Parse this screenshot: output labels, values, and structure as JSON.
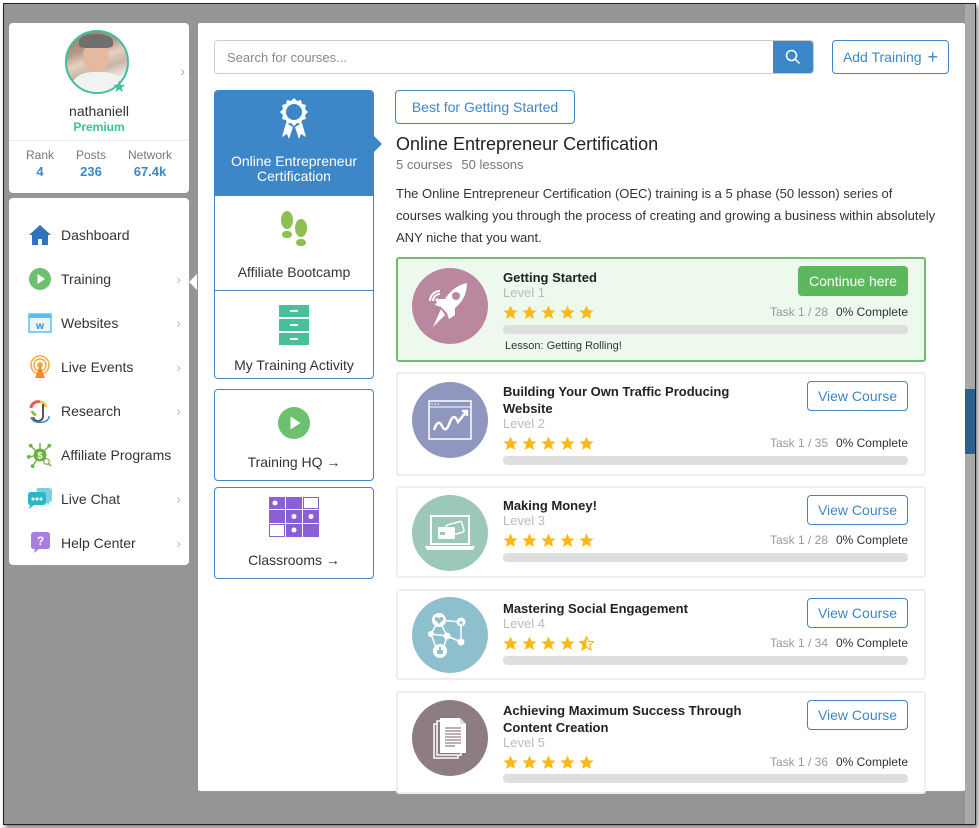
{
  "profile": {
    "username": "nathaniell",
    "tier": "Premium",
    "stats": [
      {
        "label": "Rank",
        "value": "4"
      },
      {
        "label": "Posts",
        "value": "236"
      },
      {
        "label": "Network",
        "value": "67.4k"
      }
    ]
  },
  "nav": {
    "items": [
      {
        "label": "Dashboard",
        "icon": "home-icon",
        "chevron": false
      },
      {
        "label": "Training",
        "icon": "play-circle-icon",
        "chevron": true
      },
      {
        "label": "Websites",
        "icon": "website-icon",
        "chevron": true
      },
      {
        "label": "Live Events",
        "icon": "broadcast-icon",
        "chevron": true
      },
      {
        "label": "Research",
        "icon": "research-icon",
        "chevron": true
      },
      {
        "label": "Affiliate Programs",
        "icon": "affiliate-dollar-icon",
        "chevron": false
      },
      {
        "label": "Live Chat",
        "icon": "chat-bubble-icon",
        "chevron": true
      },
      {
        "label": "Help Center",
        "icon": "help-question-icon",
        "chevron": true
      }
    ]
  },
  "search": {
    "placeholder": "Search for courses...",
    "value": ""
  },
  "toolbar": {
    "add_training_label": "Add Training",
    "add_training_icon": "+"
  },
  "categories": {
    "group": [
      {
        "label": "Online Entrepreneur Certification",
        "icon": "award-ribbon-icon",
        "active": true
      },
      {
        "label": "Affiliate Bootcamp",
        "icon": "footsteps-icon",
        "active": false
      },
      {
        "label": "My Training Activity",
        "icon": "file-cabinet-icon",
        "active": false
      }
    ],
    "links": [
      {
        "label": "Training HQ →",
        "icon": "play-circle-icon"
      },
      {
        "label": "Classrooms →",
        "icon": "classroom-grid-icon"
      }
    ]
  },
  "program": {
    "tag": "Best for Getting Started",
    "title": "Online Entrepreneur Certification",
    "courses_count": "5 courses",
    "lessons_count": "50 lessons",
    "description": "The Online Entrepreneur Certification (OEC) training is a 5 phase (50 lesson) series of courses walking you through the process of creating and growing a business within absolutely ANY niche that you want."
  },
  "courses": [
    {
      "title": "Getting Started",
      "level": "Level 1",
      "rating": 5,
      "task": "Task 1 / 28",
      "complete": "0% Complete",
      "progress": 0,
      "button": "Continue here",
      "lesson": "Lesson: Getting Rolling!",
      "current": true,
      "icon": "rocket-icon",
      "color": "#b9889f"
    },
    {
      "title": "Building Your Own Traffic Producing Website",
      "level": "Level 2",
      "rating": 5,
      "task": "Task 1 / 35",
      "complete": "0% Complete",
      "progress": 0,
      "button": "View Course",
      "current": false,
      "icon": "website-growth-icon",
      "color": "#8f97bf"
    },
    {
      "title": "Making Money!",
      "level": "Level 3",
      "rating": 5,
      "task": "Task 1 / 28",
      "complete": "0% Complete",
      "progress": 0,
      "button": "View Course",
      "current": false,
      "icon": "laptop-credit-card-icon",
      "color": "#9cc8b8"
    },
    {
      "title": "Mastering Social Engagement",
      "level": "Level 4",
      "rating": 4.5,
      "task": "Task 1 / 34",
      "complete": "0% Complete",
      "progress": 0,
      "button": "View Course",
      "current": false,
      "icon": "social-network-icon",
      "color": "#8dbfcc"
    },
    {
      "title": "Achieving Maximum Success Through Content Creation",
      "level": "Level 5",
      "rating": 5,
      "task": "Task 1 / 36",
      "complete": "0% Complete",
      "progress": 0,
      "button": "View Course",
      "current": false,
      "icon": "documents-icon",
      "color": "#8e7c85"
    }
  ],
  "colors": {
    "accent": "#3d87c8",
    "premium": "#3fbf9a",
    "success": "#5cb85c",
    "star": "#fbb917"
  }
}
